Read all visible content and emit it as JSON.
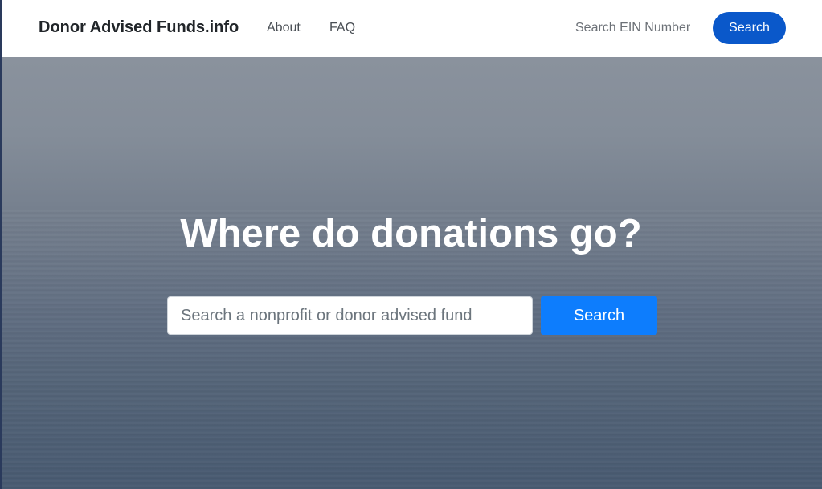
{
  "navbar": {
    "brand": "Donor Advised Funds.info",
    "links": [
      {
        "label": "About"
      },
      {
        "label": "FAQ"
      }
    ],
    "ein_search": {
      "placeholder": "Search EIN Number",
      "value": ""
    },
    "search_label": "Search",
    "search_button_color": "#0a58ca"
  },
  "hero": {
    "title": "Where do donations go?",
    "search": {
      "placeholder": "Search a nonprofit or donor advised fund",
      "value": ""
    },
    "search_label": "Search",
    "search_button_color": "#0d7dfd"
  }
}
